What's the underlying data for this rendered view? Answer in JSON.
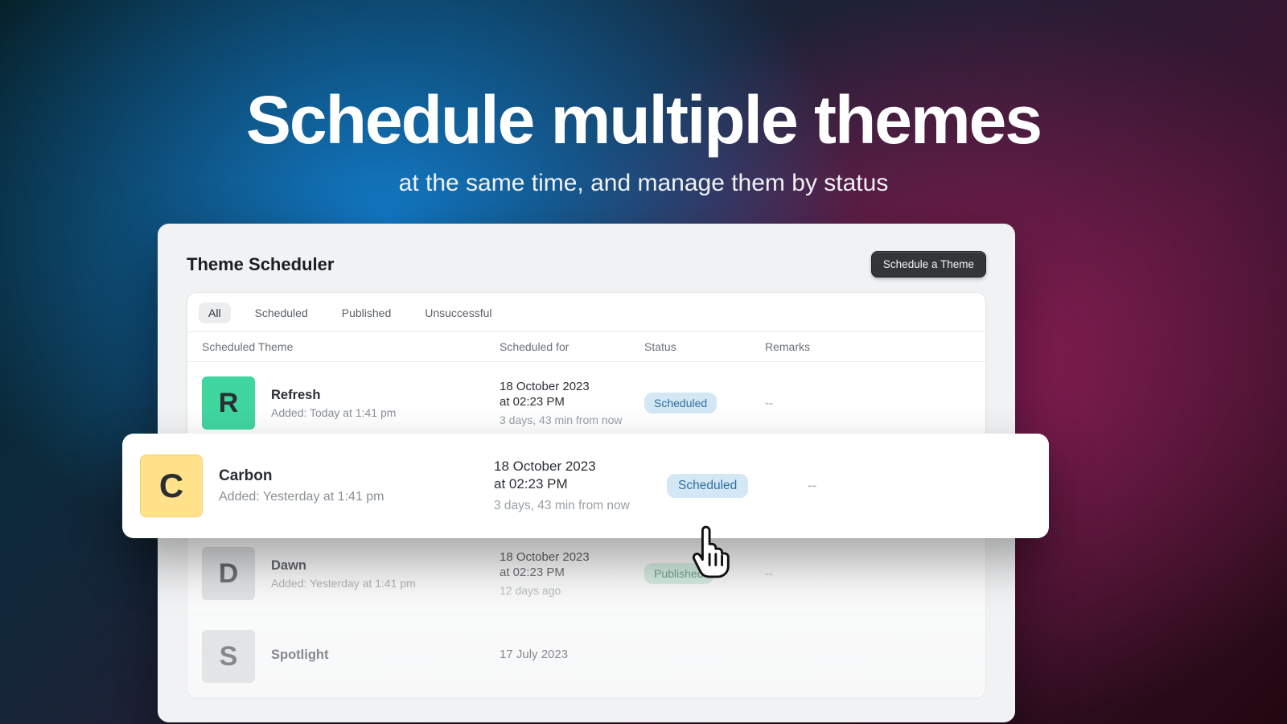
{
  "hero": {
    "title": "Schedule multiple themes",
    "subtitle": "at the same time, and manage them by status"
  },
  "panel": {
    "title": "Theme Scheduler",
    "cta": "Schedule a Theme"
  },
  "tabs": [
    "All",
    "Scheduled",
    "Published",
    "Unsuccessful"
  ],
  "activeTabIndex": 0,
  "columns": [
    "Scheduled Theme",
    "Scheduled for",
    "Status",
    "Remarks"
  ],
  "rows": [
    {
      "letter": "R",
      "swatch": "sw-green",
      "name": "Refresh",
      "added": "Added: Today at 1:41 pm",
      "date": "18 October 2023",
      "time": "at 02:23 PM",
      "relative": "3 days, 43 min from now",
      "status": "Scheduled",
      "statusClass": "badge-sched",
      "remarks": "--"
    },
    {
      "letter": "D",
      "swatch": "sw-grey",
      "name": "Dawn",
      "added": "Added: Yesterday at 1:41 pm",
      "date": "18 October 2023",
      "time": "at 02:23 PM",
      "relative": "12 days ago",
      "status": "Published",
      "statusClass": "badge-pub",
      "remarks": "--"
    },
    {
      "letter": "S",
      "swatch": "sw-grey2",
      "name": "Spotlight",
      "added": "",
      "date": "17 July 2023",
      "time": "",
      "relative": "",
      "status": "",
      "statusClass": "",
      "remarks": ""
    }
  ],
  "highlight": {
    "letter": "C",
    "name": "Carbon",
    "added": "Added: Yesterday at 1:41 pm",
    "date": "18 October 2023",
    "time": "at 02:23 PM",
    "relative": "3 days, 43 min from now",
    "status": "Scheduled",
    "remarks": "--"
  }
}
